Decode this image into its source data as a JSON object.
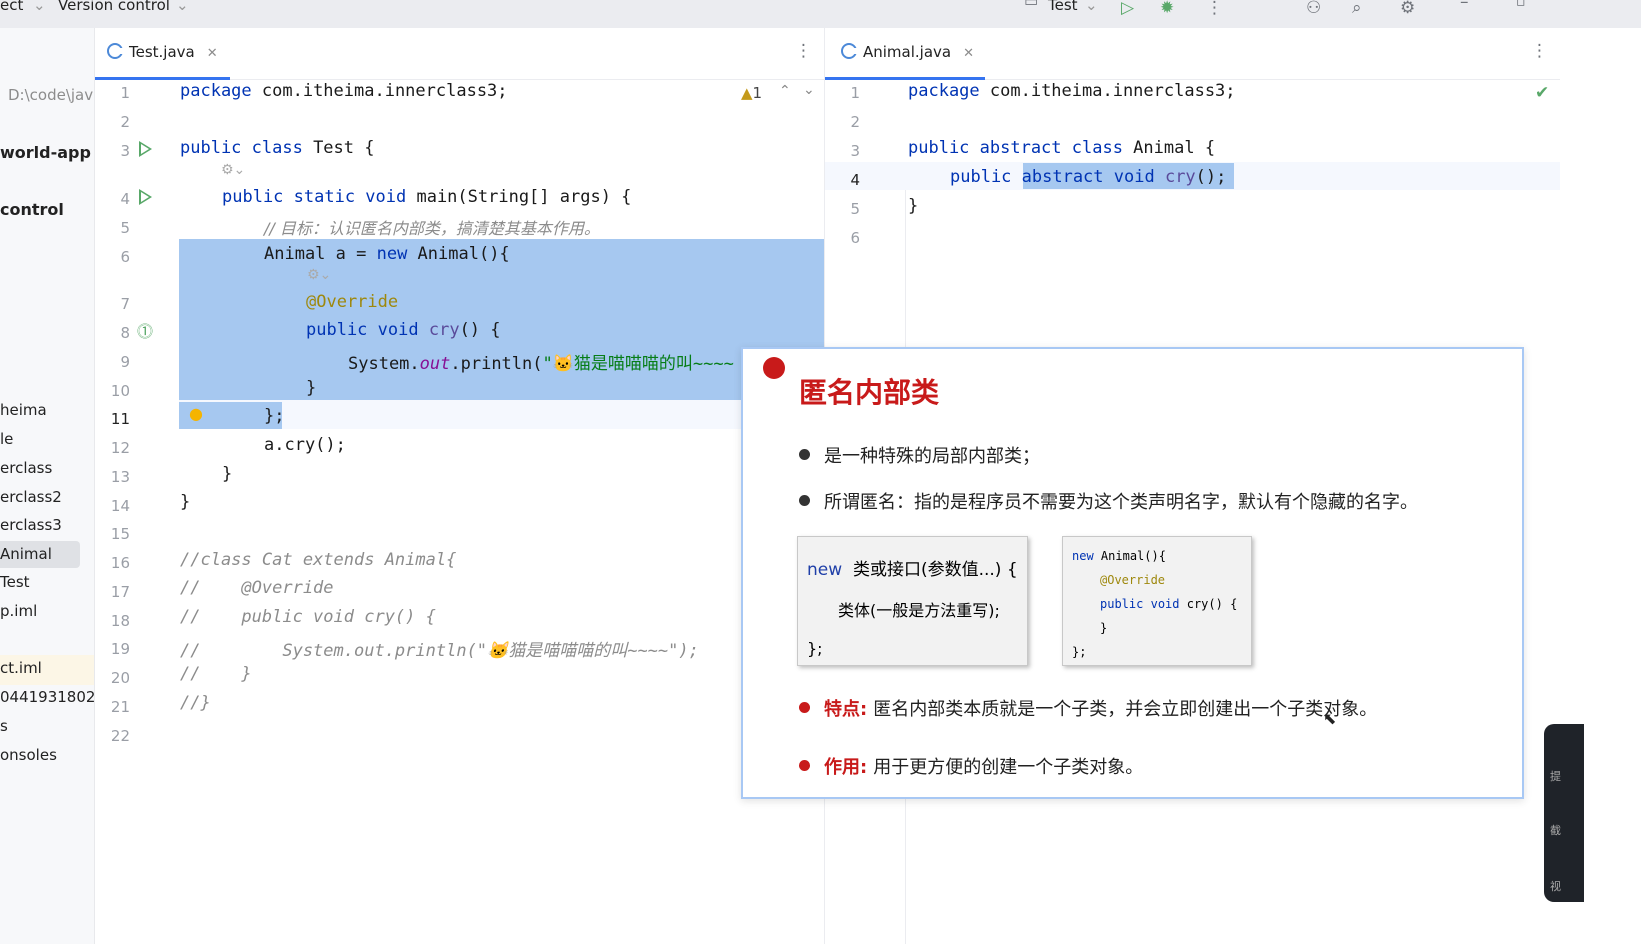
{
  "toolbar": {
    "menu_project": "ect",
    "menu_vcs": "Version control",
    "run_config": "Test",
    "icons": [
      "run-icon",
      "debug-icon",
      "more-icon",
      "add-user-icon",
      "search-icon",
      "settings-icon",
      "minimize-icon",
      "maximize-icon"
    ]
  },
  "sidebar": {
    "items": [
      {
        "label": "D:\\code\\jav",
        "style": "path"
      },
      {
        "label": "world-app",
        "style": "bold"
      },
      {
        "label": "control",
        "style": "bold"
      },
      {
        "label": "heima",
        "style": ""
      },
      {
        "label": "le",
        "style": ""
      },
      {
        "label": "erclass",
        "style": ""
      },
      {
        "label": "erclass2",
        "style": ""
      },
      {
        "label": "erclass3",
        "style": ""
      },
      {
        "label": "Animal",
        "style": "selected"
      },
      {
        "label": "Test",
        "style": ""
      },
      {
        "label": "p.iml",
        "style": ""
      },
      {
        "label": "ct.iml",
        "style": ""
      },
      {
        "label": "0441931802",
        "style": ""
      },
      {
        "label": "s",
        "style": ""
      },
      {
        "label": "onsoles",
        "style": ""
      }
    ]
  },
  "left_editor": {
    "tab": "Test.java",
    "warnings": "1",
    "line_numbers": [
      "1",
      "2",
      "3",
      "4",
      "5",
      "6",
      "7",
      "8",
      "9",
      "10",
      "11",
      "12",
      "13",
      "14",
      "15",
      "16",
      "17",
      "18",
      "19",
      "20",
      "21",
      "22"
    ]
  },
  "right_editor": {
    "tab": "Animal.java",
    "line_numbers": [
      "1",
      "2",
      "3",
      "4",
      "5",
      "6"
    ]
  },
  "slide": {
    "title": "匿名内部类",
    "bullet1": "是一种特殊的局部内部类；",
    "bullet2": "所谓匿名：指的是程序员不需要为这个类声明名字，默认有个隐藏的名字。",
    "box1": {
      "kw": "new",
      "line1": "类或接口(参数值...) {",
      "line2": "类体(一般是方法重写);",
      "line3": "};"
    },
    "box2": {
      "new": "new",
      "l1": "Animal(){",
      "ann": "@Override",
      "pub": "public",
      "void": "void",
      "m": "cry() {",
      "close1": "}",
      "close2": "};"
    },
    "feature_label": "特点:",
    "feature_text": "匿名内部类本质就是一个子类，并会立即创建出一个子类对象。",
    "purpose_label": "作用:",
    "purpose_text": "用于更方便的创建一个子类对象。"
  },
  "side_widget": {
    "labels": [
      "提",
      "截",
      "视"
    ]
  }
}
